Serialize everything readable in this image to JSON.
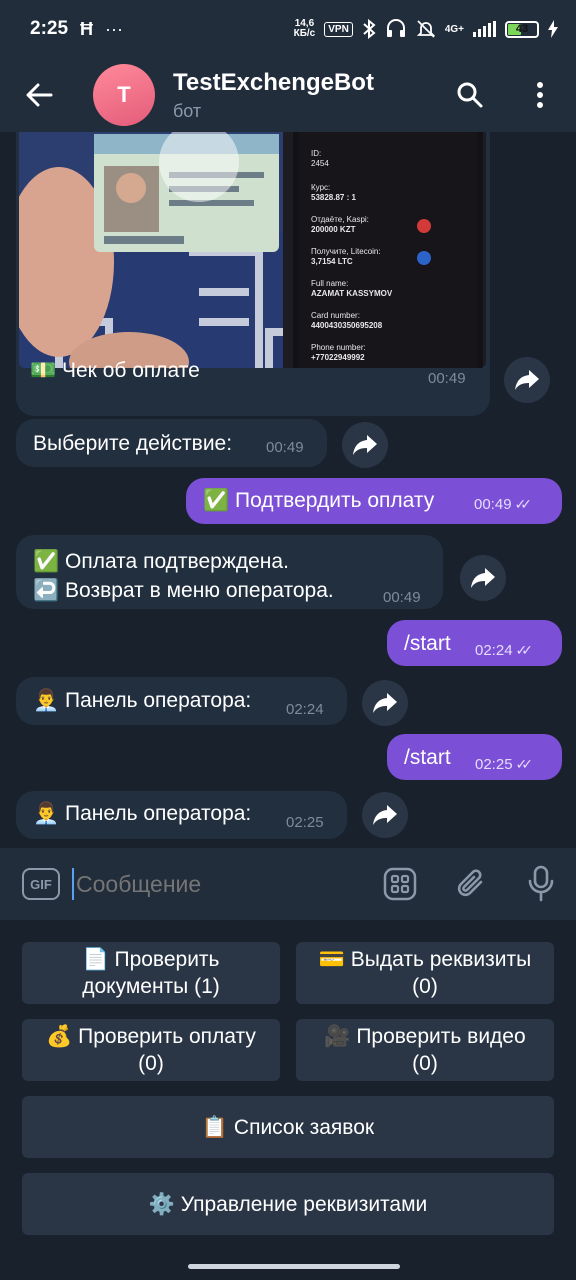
{
  "status_bar": {
    "time": "2:25",
    "speed_value": "14,6",
    "speed_unit": "КБ/с",
    "vpn": "VPN",
    "network": "4G+",
    "battery": "43"
  },
  "header": {
    "avatar_letter": "T",
    "title": "TestExchengeBot",
    "subtitle": "бот"
  },
  "photo": {
    "card_lines": [
      "ID:",
      "2454",
      "Курс:",
      "53828.87 : 1",
      "Отдаёте, Kaspi:",
      "200000 KZT",
      "Получите, Litecoin:",
      "3,7154 LTC",
      "Full name:",
      "AZAMAT KASSYMOV",
      "Card number:",
      "4400430350695208",
      "Phone number:",
      "+77022949992"
    ]
  },
  "messages": [
    {
      "id": "m1",
      "direction": "in",
      "emoji": "💵",
      "text": "Чек об оплате",
      "time": "00:49"
    },
    {
      "id": "m2",
      "direction": "in",
      "text": "Выберите действие:",
      "time": "00:49"
    },
    {
      "id": "m3",
      "direction": "out",
      "emoji": "✅",
      "text": "Подтвердить оплату",
      "time": "00:49"
    },
    {
      "id": "m4",
      "direction": "in",
      "line1_emoji": "✅",
      "line1": "Оплата подтверждена.",
      "line2_emoji": "↩️",
      "line2": "Возврат в меню оператора.",
      "time": "00:49"
    },
    {
      "id": "m5",
      "direction": "out",
      "text": "/start",
      "time": "02:24"
    },
    {
      "id": "m6",
      "direction": "in",
      "emoji": "👨‍💼",
      "text": "Панель оператора:",
      "time": "02:24"
    },
    {
      "id": "m7",
      "direction": "out",
      "text": "/start",
      "time": "02:25"
    },
    {
      "id": "m8",
      "direction": "in",
      "emoji": "👨‍💼",
      "text": "Панель оператора:",
      "time": "02:25"
    }
  ],
  "input": {
    "gif_label": "GIF",
    "placeholder": "Сообщение"
  },
  "keyboard": {
    "buttons": [
      {
        "emoji": "📄",
        "line1": "Проверить",
        "line2": "документы (1)"
      },
      {
        "emoji": "💳",
        "line1": "Выдать реквизиты",
        "line2": "(0)"
      },
      {
        "emoji": "💰",
        "line1": "Проверить оплату",
        "line2": "(0)"
      },
      {
        "emoji": "🎥",
        "line1": "Проверить видео",
        "line2": "(0)"
      },
      {
        "emoji": "📋",
        "line1": "Список заявок",
        "line2": ""
      },
      {
        "emoji": "⚙️",
        "line1": "Управление реквизитами",
        "line2": ""
      }
    ]
  },
  "colors": {
    "accent": "#7b4fd6",
    "header_bg": "#212d3b",
    "chat_bg": "#18212c",
    "incoming_bubble": "#222f3f",
    "keyboard_button": "#2a3646"
  }
}
